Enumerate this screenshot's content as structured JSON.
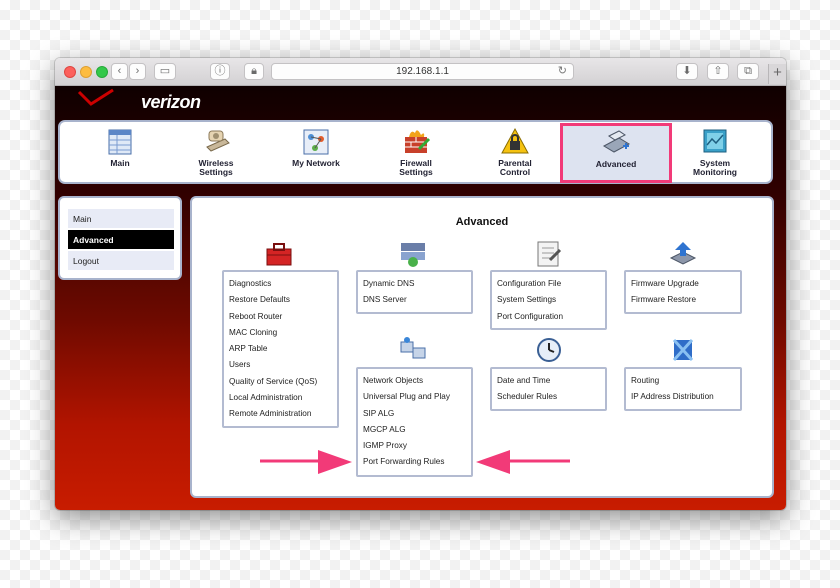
{
  "browser": {
    "url": "192.168.1.1"
  },
  "brand": {
    "name": "verizon",
    "accent": "#f23a78",
    "logo_color": "#cc0000"
  },
  "nav": {
    "items": [
      {
        "label_line1": "Main",
        "label_line2": "",
        "icon": "grid-icon"
      },
      {
        "label_line1": "Wireless",
        "label_line2": "Settings",
        "icon": "wireless-router-icon"
      },
      {
        "label_line1": "My Network",
        "label_line2": "",
        "icon": "network-icon"
      },
      {
        "label_line1": "Firewall",
        "label_line2": "Settings",
        "icon": "firewall-icon"
      },
      {
        "label_line1": "Parental",
        "label_line2": "Control",
        "icon": "lock-icon"
      },
      {
        "label_line1": "Advanced",
        "label_line2": "",
        "icon": "scanner-icon",
        "active": true
      },
      {
        "label_line1": "System",
        "label_line2": "Monitoring",
        "icon": "monitor-icon"
      }
    ]
  },
  "sidebar": {
    "items": [
      {
        "label": "Main"
      },
      {
        "label": "Advanced",
        "active": true
      },
      {
        "label": "Logout"
      }
    ]
  },
  "main": {
    "title": "Advanced",
    "groups": [
      {
        "icon": "toolbox-icon",
        "items": [
          "Diagnostics",
          "Restore Defaults",
          "Reboot Router",
          "MAC Cloning",
          "ARP Table",
          "Users",
          "Quality of Service (QoS)",
          "Local Administration",
          "Remote Administration"
        ]
      },
      {
        "icon": "dns-icon",
        "items": [
          "Dynamic DNS",
          "DNS Server"
        ]
      },
      {
        "icon": "config-file-icon",
        "items": [
          "Configuration File",
          "System Settings",
          "Port Configuration"
        ]
      },
      {
        "icon": "firmware-upgrade-icon",
        "items": [
          "Firmware Upgrade",
          "Firmware Restore"
        ]
      },
      {
        "icon": "network-objects-icon",
        "items": [
          "Network Objects",
          "Universal Plug and Play",
          "SIP ALG",
          "MGCP ALG",
          "IGMP Proxy",
          "Port Forwarding Rules"
        ]
      },
      {
        "icon": "clock-icon",
        "items": [
          "Date and Time",
          "Scheduler Rules"
        ]
      },
      {
        "icon": "routing-icon",
        "items": [
          "Routing",
          "IP Address Distribution"
        ]
      }
    ]
  }
}
